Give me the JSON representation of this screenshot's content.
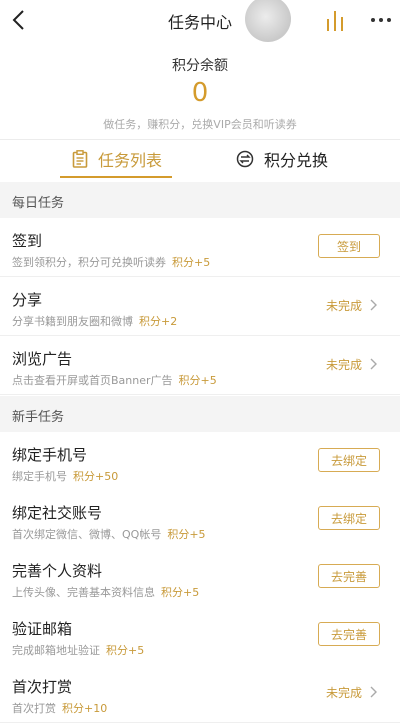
{
  "header": {
    "title": "任务中心"
  },
  "balance": {
    "label": "积分余额",
    "value": "0",
    "subtitle": "做任务，赚积分，兑换VIP会员和听读券"
  },
  "tabs": [
    {
      "label": "任务列表"
    },
    {
      "label": "积分兑换"
    }
  ],
  "sections": [
    {
      "label": "每日任务"
    },
    {
      "label": "新手任务"
    }
  ],
  "rows": [
    {
      "title": "签到",
      "desc": "签到领积分，积分可兑换听读券",
      "points": "积分+5",
      "action": "签到"
    },
    {
      "title": "分享",
      "desc": "分享书籍到朋友圈和微博",
      "points": "积分+2",
      "status": "未完成"
    },
    {
      "title": "浏览广告",
      "desc": "点击查看开屏或首页Banner广告",
      "points": "积分+5",
      "status": "未完成"
    },
    {
      "title": "绑定手机号",
      "desc": "绑定手机号",
      "points": "积分+50",
      "action": "去绑定"
    },
    {
      "title": "绑定社交账号",
      "desc": "首次绑定微信、微博、QQ帐号",
      "points": "积分+5",
      "action": "去绑定"
    },
    {
      "title": "完善个人资料",
      "desc": "上传头像、完善基本资料信息",
      "points": "积分+5",
      "action": "去完善"
    },
    {
      "title": "验证邮箱",
      "desc": "完成邮箱地址验证",
      "points": "积分+5",
      "action": "去完善"
    },
    {
      "title": "首次打赏",
      "desc": "首次打赏",
      "points": "积分+10",
      "status": "未完成"
    }
  ],
  "colors": {
    "accent": "#d49b2c",
    "section_bg": "#f4f4f4"
  },
  "icons": {
    "back": "chevron-left-icon",
    "stats": "bar-chart-icon",
    "more": "more-dots-icon",
    "tasks": "clipboard-icon",
    "exchange": "swap-arrows-icon"
  }
}
